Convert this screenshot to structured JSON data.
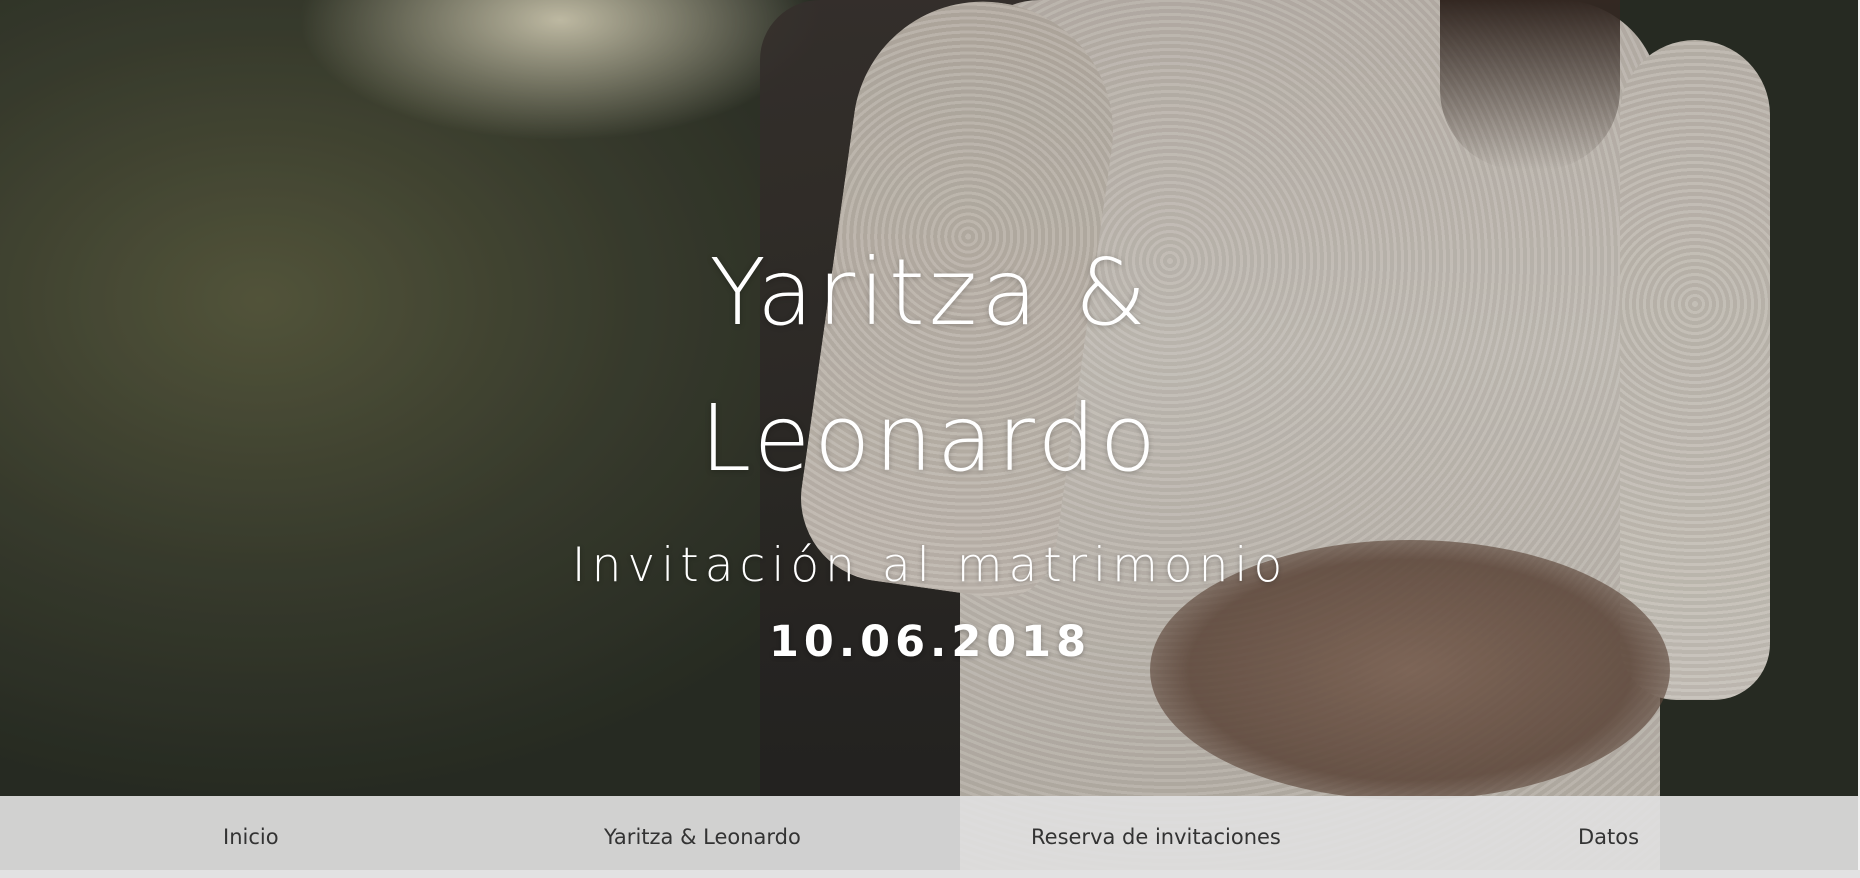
{
  "hero": {
    "names_line1": "Yaritza &",
    "names_line2": "Leonardo",
    "subtitle": "Invitación al matrimonio",
    "date": "10.06.2018",
    "background_image": "couple-embrace-photo"
  },
  "nav": {
    "items": [
      {
        "label": "Inicio"
      },
      {
        "label": "Yaritza & Leonardo"
      },
      {
        "label": "Reserva de invitaciones"
      },
      {
        "label": "Datos"
      }
    ]
  },
  "colors": {
    "hero_text": "#ffffff",
    "nav_background": "#e0e0e0",
    "nav_text": "#333333"
  }
}
